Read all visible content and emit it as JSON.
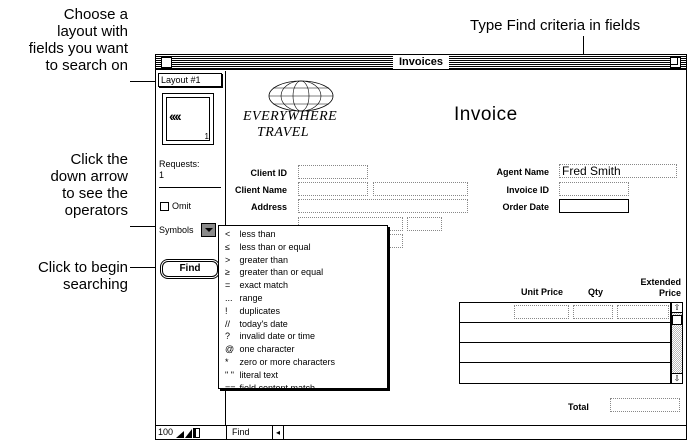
{
  "callouts": {
    "layout": [
      "Choose a",
      "layout with",
      "fields you want",
      "to search on"
    ],
    "type_find": "Type Find criteria in fields",
    "down_arrow": [
      "Click the",
      "down arrow",
      "to see the",
      "operators"
    ],
    "begin": [
      "Click to begin",
      "searching"
    ]
  },
  "window": {
    "title": "Invoices"
  },
  "status_area": {
    "layout_label": "Layout #1",
    "book_page_number": "1",
    "requests_label": "Requests:",
    "requests_count": "1",
    "omit_label": "Omit",
    "symbols_label": "Symbols",
    "find_button": "Find"
  },
  "layout": {
    "brand_line1": "EVERYWHERE",
    "brand_line2": "TRAVEL",
    "title": "Invoice",
    "labels": {
      "client_id": "Client ID",
      "client_name": "Client Name",
      "address": "Address",
      "agent_name": "Agent Name",
      "invoice_id": "Invoice ID",
      "order_date": "Order Date",
      "unit_price": "Unit Price",
      "qty": "Qty",
      "extended_price_line1": "Extended",
      "extended_price_line2": "Price",
      "total": "Total"
    },
    "fields": {
      "agent_name_value": "Fred Smith"
    }
  },
  "bottom_bar": {
    "zoom_percent": "100",
    "mode": "Find"
  },
  "symbols_menu": {
    "items": [
      {
        "symbol": "<",
        "label": "less than"
      },
      {
        "symbol": "≤",
        "label": "less than or equal"
      },
      {
        "symbol": ">",
        "label": "greater than"
      },
      {
        "symbol": "≥",
        "label": "greater than or equal"
      },
      {
        "symbol": "=",
        "label": "exact match"
      },
      {
        "symbol": "...",
        "label": "range"
      },
      {
        "symbol": "!",
        "label": "duplicates"
      },
      {
        "symbol": "//",
        "label": "today's date"
      },
      {
        "symbol": "?",
        "label": "invalid date or time"
      },
      {
        "symbol": "@",
        "label": "one character"
      },
      {
        "symbol": "*",
        "label": "zero or more characters"
      },
      {
        "symbol": "\" \"",
        "label": "literal text"
      },
      {
        "symbol": "==",
        "label": "field content match"
      }
    ]
  }
}
